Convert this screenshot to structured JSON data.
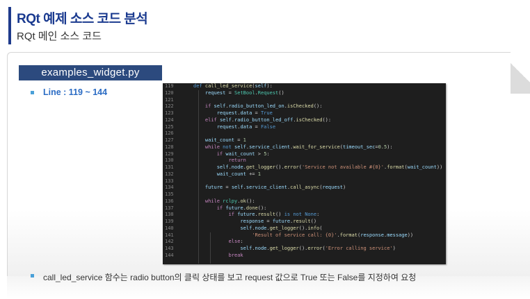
{
  "header": {
    "title": "RQt 예제 소스 코드 분석",
    "subtitle": "RQt 메인 소스 코드"
  },
  "file_tab": "examples_widget.py",
  "line_range": "Line : 119 ~ 144",
  "description": "call_led_service 함수는 radio button의 클릭 상태를 보고 request 값으로 True 또는 False를 지정하여 요청",
  "colors": {
    "title": "#1a3a8f",
    "tab_bg": "#2c4a7e",
    "bullet": "#4aa0d8",
    "code_bg": "#1e1e1e"
  },
  "code_lines": [
    {
      "ln": "119",
      "tokens": [
        [
          "t-kw",
          "def "
        ],
        [
          "t-fn",
          "call_led_service"
        ],
        [
          "t-pl",
          "("
        ],
        [
          "t-var",
          "self"
        ],
        [
          "t-pl",
          "):"
        ]
      ]
    },
    {
      "ln": "120",
      "tokens": [
        [
          "t-pl",
          "    "
        ],
        [
          "t-var",
          "request"
        ],
        [
          "t-pl",
          " = "
        ],
        [
          "t-cls",
          "SetBool"
        ],
        [
          "t-pl",
          "."
        ],
        [
          "t-cls",
          "Request"
        ],
        [
          "t-pl",
          "()"
        ]
      ]
    },
    {
      "ln": "121",
      "tokens": []
    },
    {
      "ln": "122",
      "tokens": [
        [
          "t-pl",
          "    "
        ],
        [
          "t-ctl",
          "if "
        ],
        [
          "t-var",
          "self"
        ],
        [
          "t-pl",
          "."
        ],
        [
          "t-var",
          "radio_button_led_on"
        ],
        [
          "t-pl",
          "."
        ],
        [
          "t-fn",
          "isChecked"
        ],
        [
          "t-pl",
          "():"
        ]
      ]
    },
    {
      "ln": "123",
      "tokens": [
        [
          "t-pl",
          "        "
        ],
        [
          "t-var",
          "request"
        ],
        [
          "t-pl",
          "."
        ],
        [
          "t-var",
          "data"
        ],
        [
          "t-pl",
          " = "
        ],
        [
          "t-kw",
          "True"
        ]
      ]
    },
    {
      "ln": "124",
      "tokens": [
        [
          "t-pl",
          "    "
        ],
        [
          "t-ctl",
          "elif "
        ],
        [
          "t-var",
          "self"
        ],
        [
          "t-pl",
          "."
        ],
        [
          "t-var",
          "radio_button_led_off"
        ],
        [
          "t-pl",
          "."
        ],
        [
          "t-fn",
          "isChecked"
        ],
        [
          "t-pl",
          "():"
        ]
      ]
    },
    {
      "ln": "125",
      "tokens": [
        [
          "t-pl",
          "        "
        ],
        [
          "t-var",
          "request"
        ],
        [
          "t-pl",
          "."
        ],
        [
          "t-var",
          "data"
        ],
        [
          "t-pl",
          " = "
        ],
        [
          "t-kw",
          "False"
        ]
      ]
    },
    {
      "ln": "126",
      "tokens": []
    },
    {
      "ln": "127",
      "tokens": [
        [
          "t-pl",
          "    "
        ],
        [
          "t-var",
          "wait_count"
        ],
        [
          "t-pl",
          " = "
        ],
        [
          "t-num",
          "1"
        ]
      ]
    },
    {
      "ln": "128",
      "tokens": [
        [
          "t-pl",
          "    "
        ],
        [
          "t-ctl",
          "while "
        ],
        [
          "t-kw",
          "not "
        ],
        [
          "t-var",
          "self"
        ],
        [
          "t-pl",
          "."
        ],
        [
          "t-var",
          "service_client"
        ],
        [
          "t-pl",
          "."
        ],
        [
          "t-fn",
          "wait_for_service"
        ],
        [
          "t-pl",
          "("
        ],
        [
          "t-var",
          "timeout_sec"
        ],
        [
          "t-pl",
          "="
        ],
        [
          "t-num",
          "0.5"
        ],
        [
          "t-pl",
          "):"
        ]
      ]
    },
    {
      "ln": "129",
      "tokens": [
        [
          "t-pl",
          "        "
        ],
        [
          "t-ctl",
          "if "
        ],
        [
          "t-var",
          "wait_count"
        ],
        [
          "t-pl",
          " > "
        ],
        [
          "t-num",
          "5"
        ],
        [
          "t-pl",
          ":"
        ]
      ]
    },
    {
      "ln": "130",
      "tokens": [
        [
          "t-pl",
          "            "
        ],
        [
          "t-ctl",
          "return"
        ]
      ]
    },
    {
      "ln": "131",
      "tokens": [
        [
          "t-pl",
          "        "
        ],
        [
          "t-var",
          "self"
        ],
        [
          "t-pl",
          "."
        ],
        [
          "t-var",
          "node"
        ],
        [
          "t-pl",
          "."
        ],
        [
          "t-fn",
          "get_logger"
        ],
        [
          "t-pl",
          "()."
        ],
        [
          "t-fn",
          "error"
        ],
        [
          "t-pl",
          "("
        ],
        [
          "t-str",
          "'Service not available #{0}'"
        ],
        [
          "t-pl",
          "."
        ],
        [
          "t-fn",
          "format"
        ],
        [
          "t-pl",
          "("
        ],
        [
          "t-var",
          "wait_count"
        ],
        [
          "t-pl",
          "))"
        ]
      ]
    },
    {
      "ln": "132",
      "tokens": [
        [
          "t-pl",
          "        "
        ],
        [
          "t-var",
          "wait_count"
        ],
        [
          "t-pl",
          " += "
        ],
        [
          "t-num",
          "1"
        ]
      ]
    },
    {
      "ln": "133",
      "tokens": []
    },
    {
      "ln": "134",
      "tokens": [
        [
          "t-pl",
          "    "
        ],
        [
          "t-var",
          "future"
        ],
        [
          "t-pl",
          " = "
        ],
        [
          "t-var",
          "self"
        ],
        [
          "t-pl",
          "."
        ],
        [
          "t-var",
          "service_client"
        ],
        [
          "t-pl",
          "."
        ],
        [
          "t-fn",
          "call_async"
        ],
        [
          "t-pl",
          "("
        ],
        [
          "t-var",
          "request"
        ],
        [
          "t-pl",
          ")"
        ]
      ]
    },
    {
      "ln": "135",
      "tokens": []
    },
    {
      "ln": "136",
      "tokens": [
        [
          "t-pl",
          "    "
        ],
        [
          "t-ctl",
          "while "
        ],
        [
          "t-cls",
          "rclpy"
        ],
        [
          "t-pl",
          "."
        ],
        [
          "t-fn",
          "ok"
        ],
        [
          "t-pl",
          "():"
        ]
      ]
    },
    {
      "ln": "137",
      "tokens": [
        [
          "t-pl",
          "        "
        ],
        [
          "t-ctl",
          "if "
        ],
        [
          "t-var",
          "future"
        ],
        [
          "t-pl",
          "."
        ],
        [
          "t-fn",
          "done"
        ],
        [
          "t-pl",
          "():"
        ]
      ]
    },
    {
      "ln": "138",
      "tokens": [
        [
          "t-pl",
          "            "
        ],
        [
          "t-ctl",
          "if "
        ],
        [
          "t-var",
          "future"
        ],
        [
          "t-pl",
          "."
        ],
        [
          "t-fn",
          "result"
        ],
        [
          "t-pl",
          "() "
        ],
        [
          "t-kw",
          "is not "
        ],
        [
          "t-kw",
          "None"
        ],
        [
          "t-pl",
          ":"
        ]
      ]
    },
    {
      "ln": "139",
      "tokens": [
        [
          "t-pl",
          "                "
        ],
        [
          "t-var",
          "response"
        ],
        [
          "t-pl",
          " = "
        ],
        [
          "t-var",
          "future"
        ],
        [
          "t-pl",
          "."
        ],
        [
          "t-fn",
          "result"
        ],
        [
          "t-pl",
          "()"
        ]
      ]
    },
    {
      "ln": "140",
      "tokens": [
        [
          "t-pl",
          "                "
        ],
        [
          "t-var",
          "self"
        ],
        [
          "t-pl",
          "."
        ],
        [
          "t-var",
          "node"
        ],
        [
          "t-pl",
          "."
        ],
        [
          "t-fn",
          "get_logger"
        ],
        [
          "t-pl",
          "()."
        ],
        [
          "t-fn",
          "info"
        ],
        [
          "t-pl",
          "("
        ]
      ]
    },
    {
      "ln": "141",
      "tokens": [
        [
          "t-pl",
          "                    "
        ],
        [
          "t-str",
          "'Result of service call: {0}'"
        ],
        [
          "t-pl",
          "."
        ],
        [
          "t-fn",
          "format"
        ],
        [
          "t-pl",
          "("
        ],
        [
          "t-var",
          "response"
        ],
        [
          "t-pl",
          "."
        ],
        [
          "t-var",
          "message"
        ],
        [
          "t-pl",
          "))"
        ]
      ]
    },
    {
      "ln": "142",
      "tokens": [
        [
          "t-pl",
          "            "
        ],
        [
          "t-ctl",
          "else"
        ],
        [
          "t-pl",
          ":"
        ]
      ]
    },
    {
      "ln": "143",
      "tokens": [
        [
          "t-pl",
          "                "
        ],
        [
          "t-var",
          "self"
        ],
        [
          "t-pl",
          "."
        ],
        [
          "t-var",
          "node"
        ],
        [
          "t-pl",
          "."
        ],
        [
          "t-fn",
          "get_logger"
        ],
        [
          "t-pl",
          "()."
        ],
        [
          "t-fn",
          "error"
        ],
        [
          "t-pl",
          "("
        ],
        [
          "t-str",
          "'Error calling service'"
        ],
        [
          "t-pl",
          ")"
        ]
      ]
    },
    {
      "ln": "144",
      "tokens": [
        [
          "t-pl",
          "            "
        ],
        [
          "t-ctl",
          "break"
        ]
      ]
    }
  ]
}
